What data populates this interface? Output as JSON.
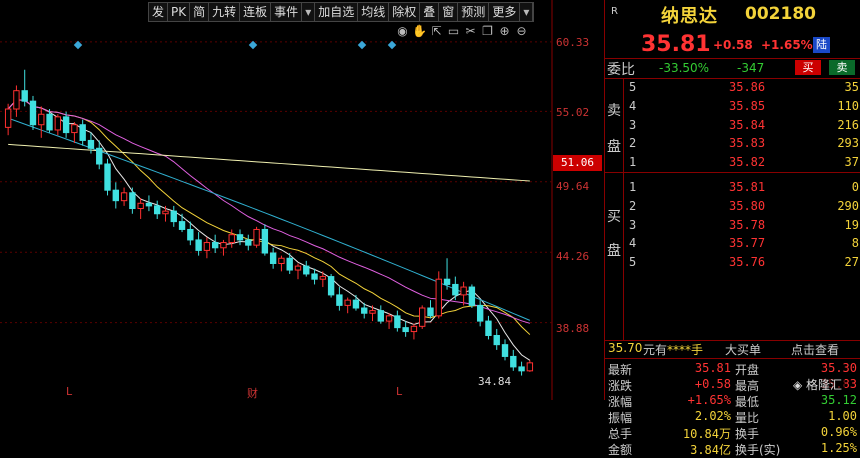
{
  "toolbar": {
    "items": [
      "发",
      "PK",
      "简",
      "九转",
      "连板",
      "事件",
      "▾",
      "加自选",
      "均线",
      "除权",
      "叠",
      "窗",
      "预测",
      "更多",
      "▾"
    ]
  },
  "chart_data": {
    "type": "candlestick",
    "price_axis_labels": [
      "60.33",
      "55.02",
      "49.64",
      "44.26",
      "38.88"
    ],
    "current_price_tag": "51.06",
    "low_label": "34.84",
    "x_markers": [
      "L",
      "财",
      "L"
    ],
    "ylim": [
      34.5,
      62
    ],
    "candles": [
      [
        53.8,
        55.6,
        53.2,
        55.2
      ],
      [
        55.2,
        57.0,
        54.6,
        56.6
      ],
      [
        56.6,
        58.2,
        55.4,
        55.8
      ],
      [
        55.8,
        56.2,
        53.6,
        54.0
      ],
      [
        54.0,
        55.4,
        53.0,
        54.8
      ],
      [
        54.8,
        55.2,
        53.4,
        53.6
      ],
      [
        53.6,
        54.8,
        53.2,
        54.6
      ],
      [
        54.6,
        55.0,
        53.0,
        53.4
      ],
      [
        53.4,
        54.2,
        52.6,
        54.0
      ],
      [
        54.0,
        54.4,
        52.4,
        52.8
      ],
      [
        52.8,
        53.4,
        51.8,
        52.2
      ],
      [
        52.2,
        52.8,
        50.6,
        51.0
      ],
      [
        51.0,
        51.4,
        48.6,
        49.0
      ],
      [
        49.0,
        49.6,
        47.6,
        48.2
      ],
      [
        48.2,
        49.2,
        47.8,
        48.8
      ],
      [
        48.8,
        49.2,
        47.2,
        47.6
      ],
      [
        47.6,
        48.4,
        46.8,
        48.0
      ],
      [
        48.0,
        48.6,
        47.4,
        47.8
      ],
      [
        47.8,
        48.2,
        46.8,
        47.2
      ],
      [
        47.2,
        47.8,
        46.6,
        47.4
      ],
      [
        47.4,
        47.8,
        46.2,
        46.6
      ],
      [
        46.6,
        47.2,
        45.8,
        46.0
      ],
      [
        46.0,
        46.6,
        44.8,
        45.2
      ],
      [
        45.2,
        45.8,
        44.0,
        44.4
      ],
      [
        44.4,
        45.4,
        43.8,
        45.0
      ],
      [
        45.0,
        45.6,
        44.2,
        44.6
      ],
      [
        44.6,
        45.2,
        44.0,
        45.0
      ],
      [
        45.0,
        46.0,
        44.6,
        45.6
      ],
      [
        45.6,
        46.0,
        44.8,
        45.2
      ],
      [
        45.2,
        45.6,
        44.4,
        44.8
      ],
      [
        44.8,
        46.2,
        44.6,
        46.0
      ],
      [
        46.0,
        46.4,
        44.0,
        44.2
      ],
      [
        44.2,
        44.6,
        43.0,
        43.4
      ],
      [
        43.4,
        44.0,
        42.8,
        43.8
      ],
      [
        43.8,
        44.2,
        42.6,
        42.9
      ],
      [
        42.9,
        43.4,
        42.2,
        43.2
      ],
      [
        43.2,
        43.6,
        42.4,
        42.6
      ],
      [
        42.6,
        43.0,
        41.8,
        42.2
      ],
      [
        42.2,
        42.8,
        41.6,
        42.4
      ],
      [
        42.4,
        42.6,
        40.8,
        41.0
      ],
      [
        41.0,
        41.6,
        39.8,
        40.2
      ],
      [
        40.2,
        40.8,
        39.6,
        40.6
      ],
      [
        40.6,
        41.0,
        39.8,
        40.0
      ],
      [
        40.0,
        40.4,
        39.2,
        39.6
      ],
      [
        39.6,
        40.2,
        39.0,
        39.8
      ],
      [
        39.8,
        40.2,
        38.8,
        39.0
      ],
      [
        39.0,
        39.6,
        38.4,
        39.4
      ],
      [
        39.4,
        39.8,
        38.2,
        38.5
      ],
      [
        38.5,
        39.0,
        37.8,
        38.2
      ],
      [
        38.2,
        38.8,
        37.6,
        38.6
      ],
      [
        38.6,
        40.2,
        38.4,
        40.0
      ],
      [
        40.0,
        40.6,
        39.2,
        39.4
      ],
      [
        39.4,
        42.8,
        39.2,
        42.2
      ],
      [
        42.2,
        43.8,
        41.4,
        41.8
      ],
      [
        41.8,
        42.4,
        40.6,
        41.0
      ],
      [
        41.0,
        42.0,
        40.2,
        41.6
      ],
      [
        41.6,
        41.8,
        40.0,
        40.2
      ],
      [
        40.2,
        40.6,
        38.6,
        39.0
      ],
      [
        39.0,
        39.4,
        37.6,
        37.9
      ],
      [
        37.9,
        38.4,
        36.8,
        37.2
      ],
      [
        37.2,
        37.6,
        36.0,
        36.3
      ],
      [
        36.3,
        36.8,
        35.2,
        35.5
      ],
      [
        35.5,
        35.9,
        34.84,
        35.2
      ],
      [
        35.2,
        36.0,
        35.12,
        35.81
      ]
    ],
    "ma": [
      {
        "name": "MA5",
        "color": "#e8e8e8"
      },
      {
        "name": "MA10",
        "color": "#f3d33a"
      },
      {
        "name": "MA20",
        "color": "#e060e0"
      },
      {
        "name": "MA60",
        "color": "#30b0d0"
      },
      {
        "name": "MA120",
        "color": "#f0f0b0"
      }
    ]
  },
  "stock": {
    "r_tag": "R",
    "name": "纳思达",
    "code": "002180",
    "price": "35.81",
    "change": "+0.58",
    "change_pct": "+1.65%",
    "market_tag": "陆"
  },
  "ratio": {
    "label": "委比",
    "value": "-33.50%",
    "diff": "-347",
    "buy": "买",
    "sell": "卖"
  },
  "sell_side_chars": [
    "卖",
    "盘"
  ],
  "buy_side_chars": [
    "买",
    "盘"
  ],
  "sell_orders": [
    {
      "level": "5",
      "price": "35.86",
      "vol": "35"
    },
    {
      "level": "4",
      "price": "35.85",
      "vol": "110"
    },
    {
      "level": "3",
      "price": "35.84",
      "vol": "216"
    },
    {
      "level": "2",
      "price": "35.83",
      "vol": "293"
    },
    {
      "level": "1",
      "price": "35.82",
      "vol": "37"
    }
  ],
  "buy_orders": [
    {
      "level": "1",
      "price": "35.81",
      "vol": "0"
    },
    {
      "level": "2",
      "price": "35.80",
      "vol": "290"
    },
    {
      "level": "3",
      "price": "35.78",
      "vol": "19"
    },
    {
      "level": "4",
      "price": "35.77",
      "vol": "8"
    },
    {
      "level": "5",
      "price": "35.76",
      "vol": "27"
    }
  ],
  "stats_head": {
    "price": "35.70",
    "unit": "元有",
    "hand": "****手",
    "bigbuy": "大买单",
    "click": "点击查看"
  },
  "stats": [
    {
      "l1": "最新",
      "v1": "35.81",
      "c1": "red",
      "l2": "开盘",
      "v2": "35.30",
      "c2": "red"
    },
    {
      "l1": "涨跌",
      "v1": "+0.58",
      "c1": "red",
      "l2": "最高",
      "v2": "35.83",
      "c2": "red"
    },
    {
      "l1": "涨幅",
      "v1": "+1.65%",
      "c1": "red",
      "l2": "最低",
      "v2": "35.12",
      "c2": "grn"
    },
    {
      "l1": "振幅",
      "v1": "2.02%",
      "c1": "yel",
      "l2": "量比",
      "v2": "1.00",
      "c2": "yel"
    },
    {
      "l1": "总手",
      "v1": "10.84万",
      "c1": "yel",
      "l2": "换手",
      "v2": "0.96%",
      "c2": "yel"
    },
    {
      "l1": "金额",
      "v1": "3.84亿",
      "c1": "yel",
      "l2": "换手(实)",
      "v2": "1.25%",
      "c2": "yel"
    }
  ],
  "watermark": "格隆汇"
}
